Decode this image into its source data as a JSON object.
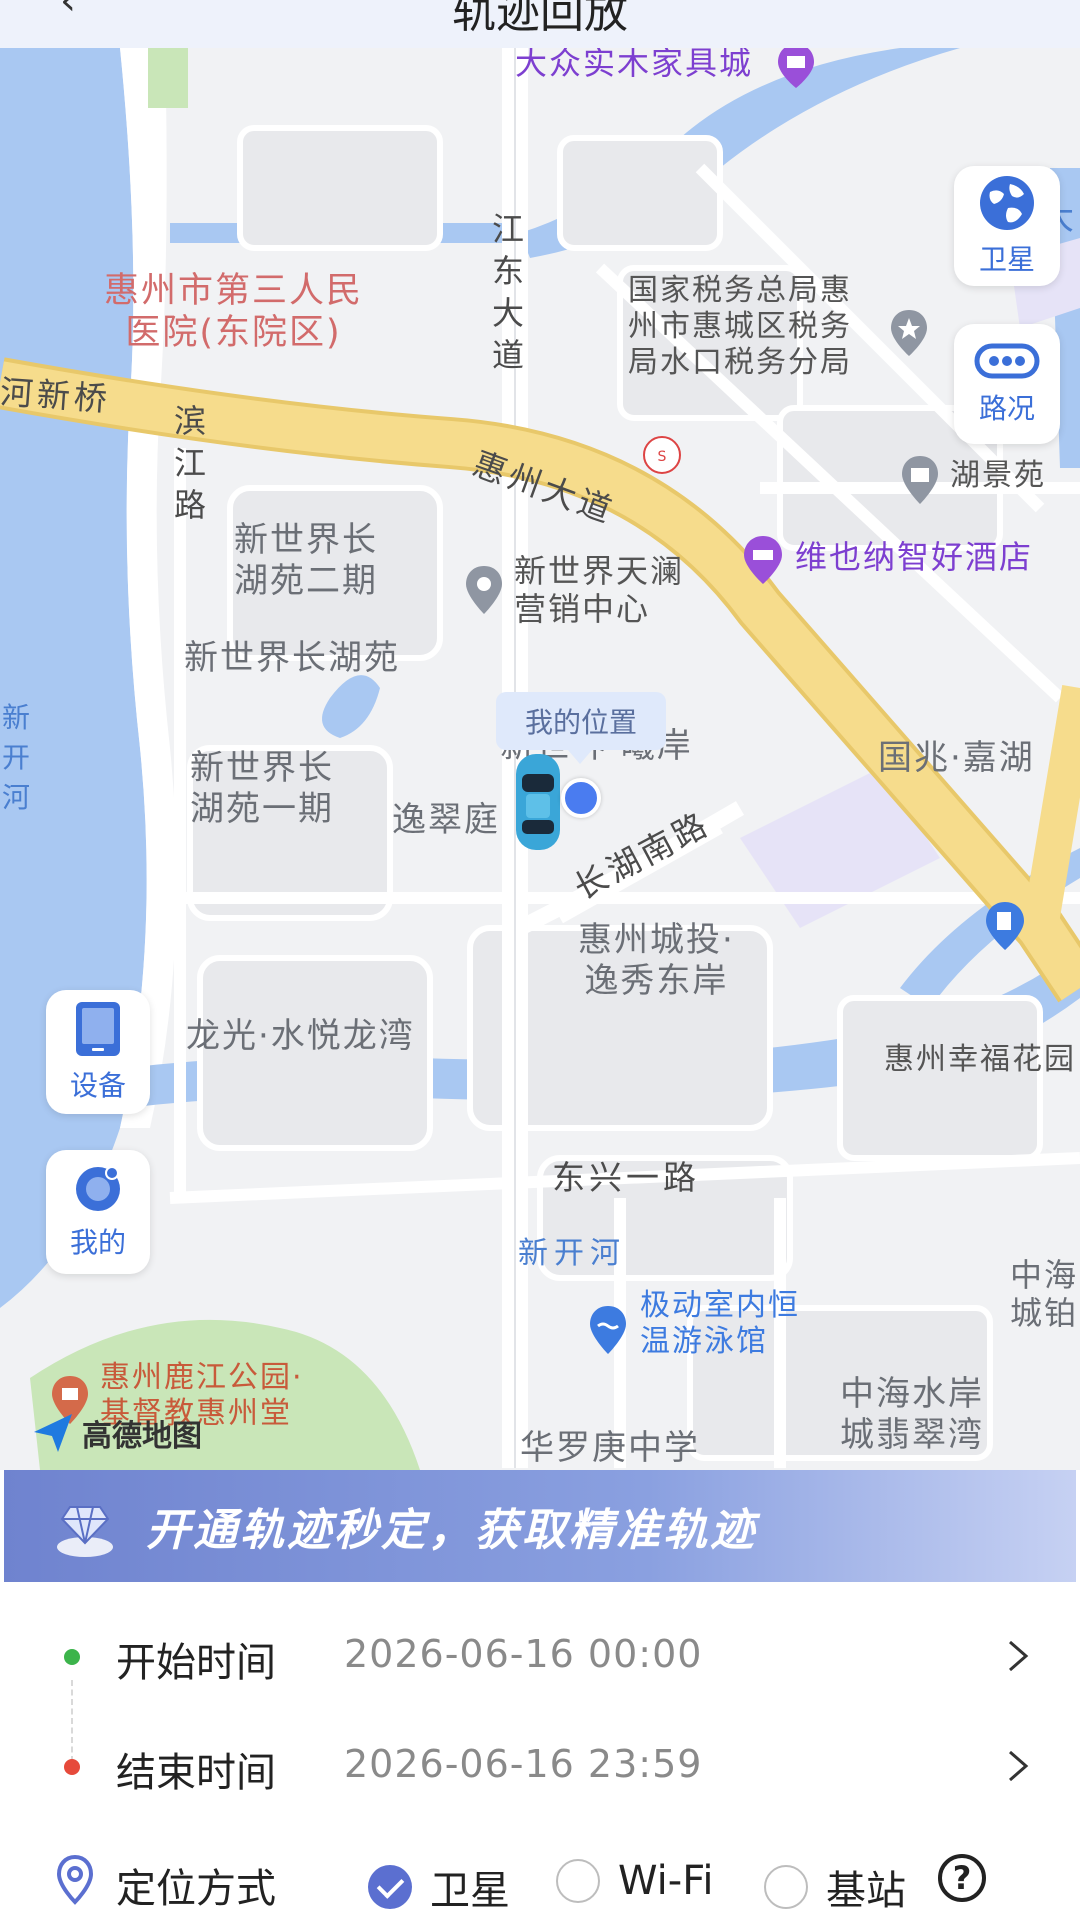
{
  "header": {
    "back_icon": "chevron-left-icon",
    "title": "轨迹回放"
  },
  "map": {
    "labels": {
      "furniture_city": "大众实木家具城",
      "hospital": "惠州市第三人民\n医院(东院区)",
      "tax_bureau": "国家税务总局惠\n州市惠城区税务\n局水口税务分局",
      "xinhe_bridge": "河新桥",
      "binjiang_road": "滨江路",
      "jiangdong_road": "江东大道",
      "huizhou_avenue": "惠州大道",
      "hujingyuan": "湖景苑",
      "vienna_hotel": "维也纳智好酒店",
      "xsj_phase2": "新世界长\n湖苑二期",
      "tianlan": "新世界天澜\n营销中心",
      "xsj_changhu": "新世界长湖苑",
      "xsj_phase1": "新世界长\n湖苑一期",
      "xsj_xian": "新世界·曦岸",
      "yicuiting": "逸翠庭",
      "changhu_south": "长湖南路",
      "guozhao": "国兆·嘉湖",
      "chengtou": "惠州城投·\n逸秀东岸",
      "longguang": "龙光·水悦龙湾",
      "xingfu": "惠州幸福花园",
      "xinkaihe_left": "新开河",
      "dongxing": "东兴一路",
      "xinkaihe": "新开河",
      "swimming": "极动室内恒\n温游泳馆",
      "zhonghai_city": "中海\n城铂",
      "zhonghai_shuian": "中海水岸\n城翡翠湾",
      "lujiang_park": "惠州鹿江公园·\n基督教惠州堂",
      "hualuogeng": "华罗庚中学",
      "da_right": "大"
    },
    "my_location_label": "我的位置",
    "logo_text": "高德地图",
    "buttons": {
      "satellite": "卫星",
      "traffic": "路况",
      "device": "设备",
      "mine": "我的"
    },
    "icons": {
      "satellite": "globe-icon",
      "traffic": "traffic-icon",
      "device": "tablet-icon",
      "mine": "user-icon",
      "car": "car-icon"
    }
  },
  "banner": {
    "text": "开通轨迹秒定，获取精准轨迹",
    "icon": "diamond-icon"
  },
  "filters": {
    "start_label": "开始时间",
    "start_value": "2026-06-16 00:00",
    "end_label": "结束时间",
    "end_value": "2026-06-16 23:59",
    "mode_label": "定位方式",
    "mode_options": [
      "卫星",
      "Wi-Fi",
      "基站"
    ],
    "mode_selected": "卫星",
    "help": "?"
  },
  "colors": {
    "accent": "#5b6fd0",
    "start_dot": "#3cb44b",
    "end_dot": "#e64a3b",
    "road_main": "#f6dc8c",
    "water": "#a9c8f2"
  }
}
